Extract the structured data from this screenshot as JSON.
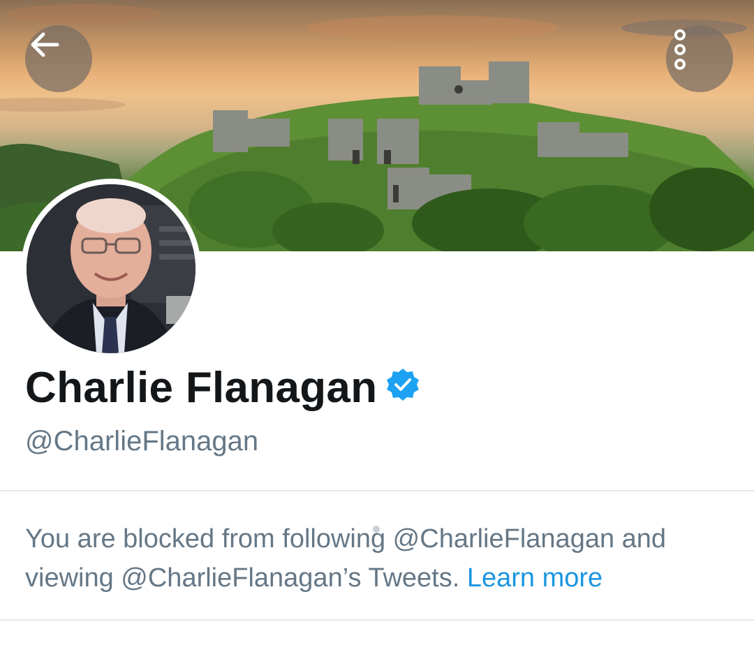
{
  "header": {
    "back_icon": "arrow-left-icon",
    "more_icon": "more-vertical-icon"
  },
  "profile": {
    "display_name": "Charlie Flanagan",
    "verified_icon": "verified-badge-icon",
    "handle": "@CharlieFlanagan"
  },
  "blocked_notice": {
    "message": "You are blocked from following @CharlieFlanagan and viewing @CharlieFlanagan’s Tweets. ",
    "learn_more": "Learn more"
  },
  "colors": {
    "accent": "#1b95e0",
    "verified": "#1da1f2",
    "muted_text": "#657786",
    "name_text": "#14171a",
    "divider": "#e1e8ed"
  }
}
